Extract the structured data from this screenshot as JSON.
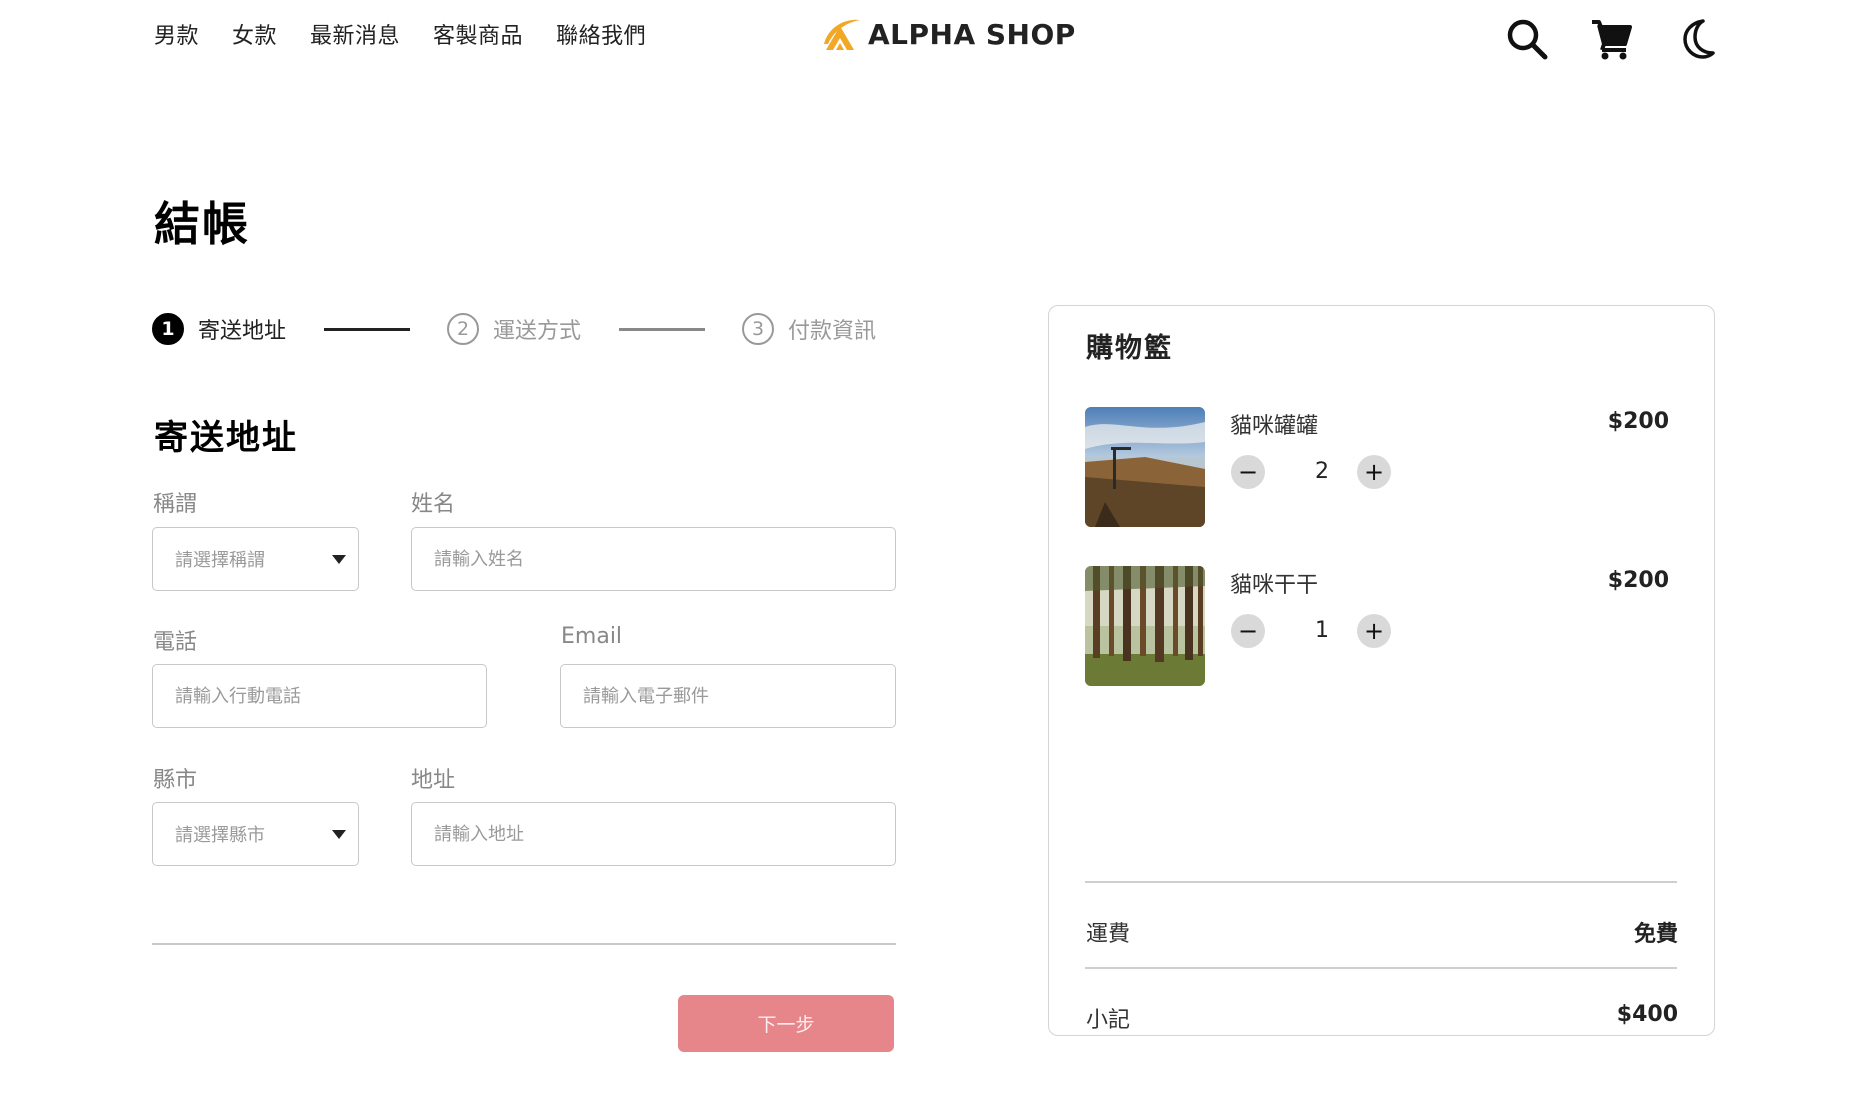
{
  "nav": {
    "items": [
      {
        "label": "男款"
      },
      {
        "label": "女款"
      },
      {
        "label": "最新消息"
      },
      {
        "label": "客製商品"
      },
      {
        "label": "聯絡我們"
      }
    ]
  },
  "logo": {
    "text": "ALPHA SHOP",
    "icon": "alpha-logo-icon"
  },
  "header_icons": [
    "search-icon",
    "cart-icon",
    "moon-icon"
  ],
  "page": {
    "title": "結帳"
  },
  "stepper": {
    "steps": [
      {
        "number": "1",
        "label": "寄送地址",
        "active": true
      },
      {
        "number": "2",
        "label": "運送方式",
        "active": false
      },
      {
        "number": "3",
        "label": "付款資訊",
        "active": false
      }
    ]
  },
  "form": {
    "title": "寄送地址",
    "salutation": {
      "label": "稱謂",
      "placeholder": "請選擇稱謂"
    },
    "name": {
      "label": "姓名",
      "placeholder": "請輸入姓名"
    },
    "phone": {
      "label": "電話",
      "placeholder": "請輸入行動電話"
    },
    "email": {
      "label": "Email",
      "placeholder": "請輸入電子郵件"
    },
    "city": {
      "label": "縣市",
      "placeholder": "請選擇縣市"
    },
    "address": {
      "label": "地址",
      "placeholder": "請輸入地址"
    },
    "next_label": "下一步"
  },
  "cart": {
    "title": "購物籃",
    "items": [
      {
        "name": "貓咪罐罐",
        "price": "$200",
        "quantity": "2",
        "image": "lakeshore-photo"
      },
      {
        "name": "貓咪干干",
        "price": "$200",
        "quantity": "1",
        "image": "forest-photo"
      }
    ],
    "shipping": {
      "label": "運費",
      "value": "免費"
    },
    "subtotal": {
      "label": "小記",
      "value": "$400"
    }
  },
  "colors": {
    "accent": "#e6858a",
    "logo_orange": "#f2a825",
    "text": "#222222",
    "muted": "#999999",
    "border": "#c8c8c8"
  }
}
